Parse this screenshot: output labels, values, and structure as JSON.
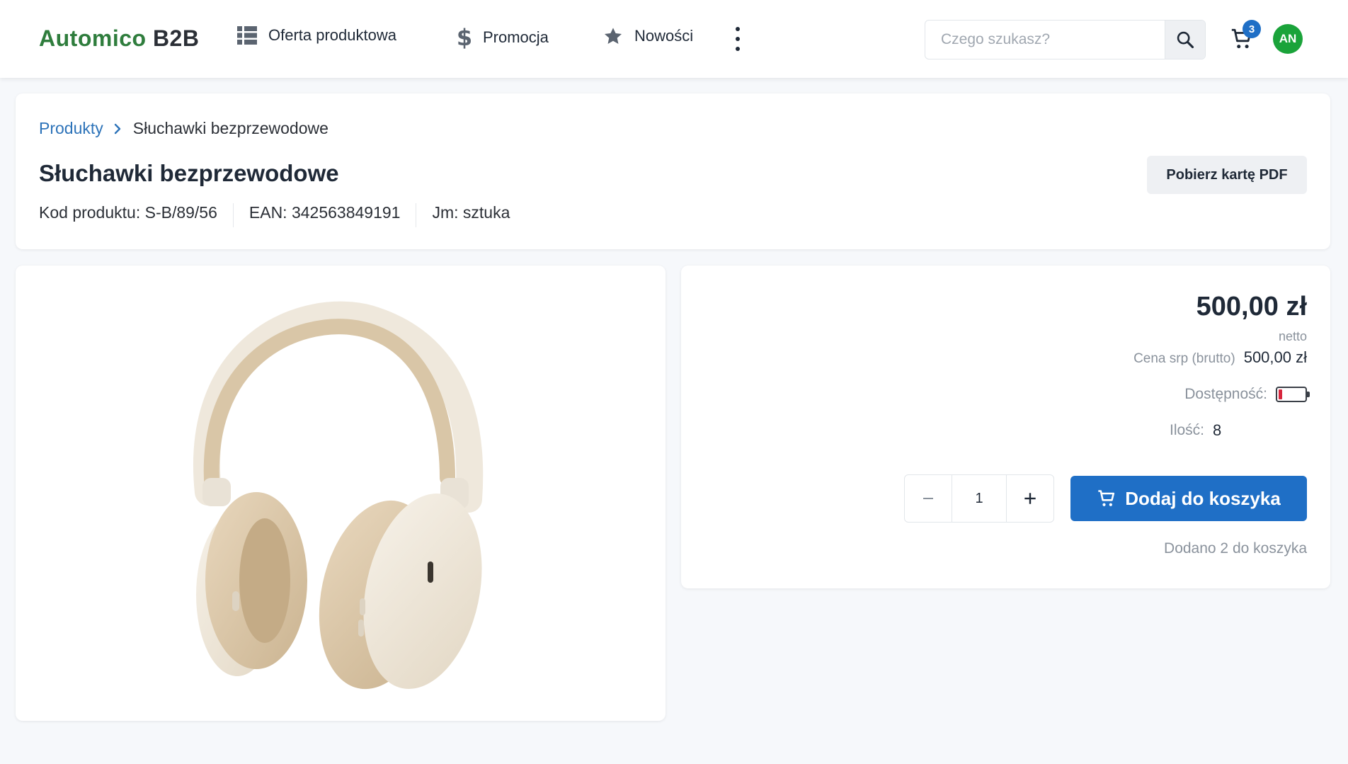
{
  "app": {
    "logo_part1": "Automico",
    "logo_part2": "B2B",
    "brand_color": "#2f7d3d",
    "accent_color": "#1f6fc6"
  },
  "nav": {
    "items": [
      {
        "label": "Oferta produktowa",
        "icon": "grid-list-icon"
      },
      {
        "label": "Promocja",
        "icon": "dollar-icon"
      },
      {
        "label": "Nowości",
        "icon": "star-icon"
      }
    ],
    "more_icon": "kebab-menu-icon"
  },
  "search": {
    "placeholder": "Czego szukasz?",
    "value": ""
  },
  "cart": {
    "count": "3"
  },
  "user": {
    "initials": "AN"
  },
  "breadcrumb": {
    "parent": "Produkty",
    "current": "Słuchawki bezprzewodowe"
  },
  "product": {
    "title": "Słuchawki bezprzewodowe",
    "code": "Kod produktu: S-B/89/56",
    "ean": "EAN: 342563849191",
    "unit": "Jm: sztuka",
    "pdf_button": "Pobierz kartę PDF",
    "image_alt": "headphones-product-image"
  },
  "pricing": {
    "price": "500,00 zł",
    "price_type": "netto",
    "srp_label": "Cena srp (brutto)",
    "srp_value": "500,00 zł",
    "availability_label": "Dostępność:",
    "availability_level": 0.15,
    "availability_color": "#d7263d",
    "quantity_label": "Ilość:",
    "quantity_value": "8"
  },
  "order": {
    "quantity": "1",
    "add_button": "Dodaj do koszyka",
    "added_message": "Dodano 2 do koszyka"
  }
}
